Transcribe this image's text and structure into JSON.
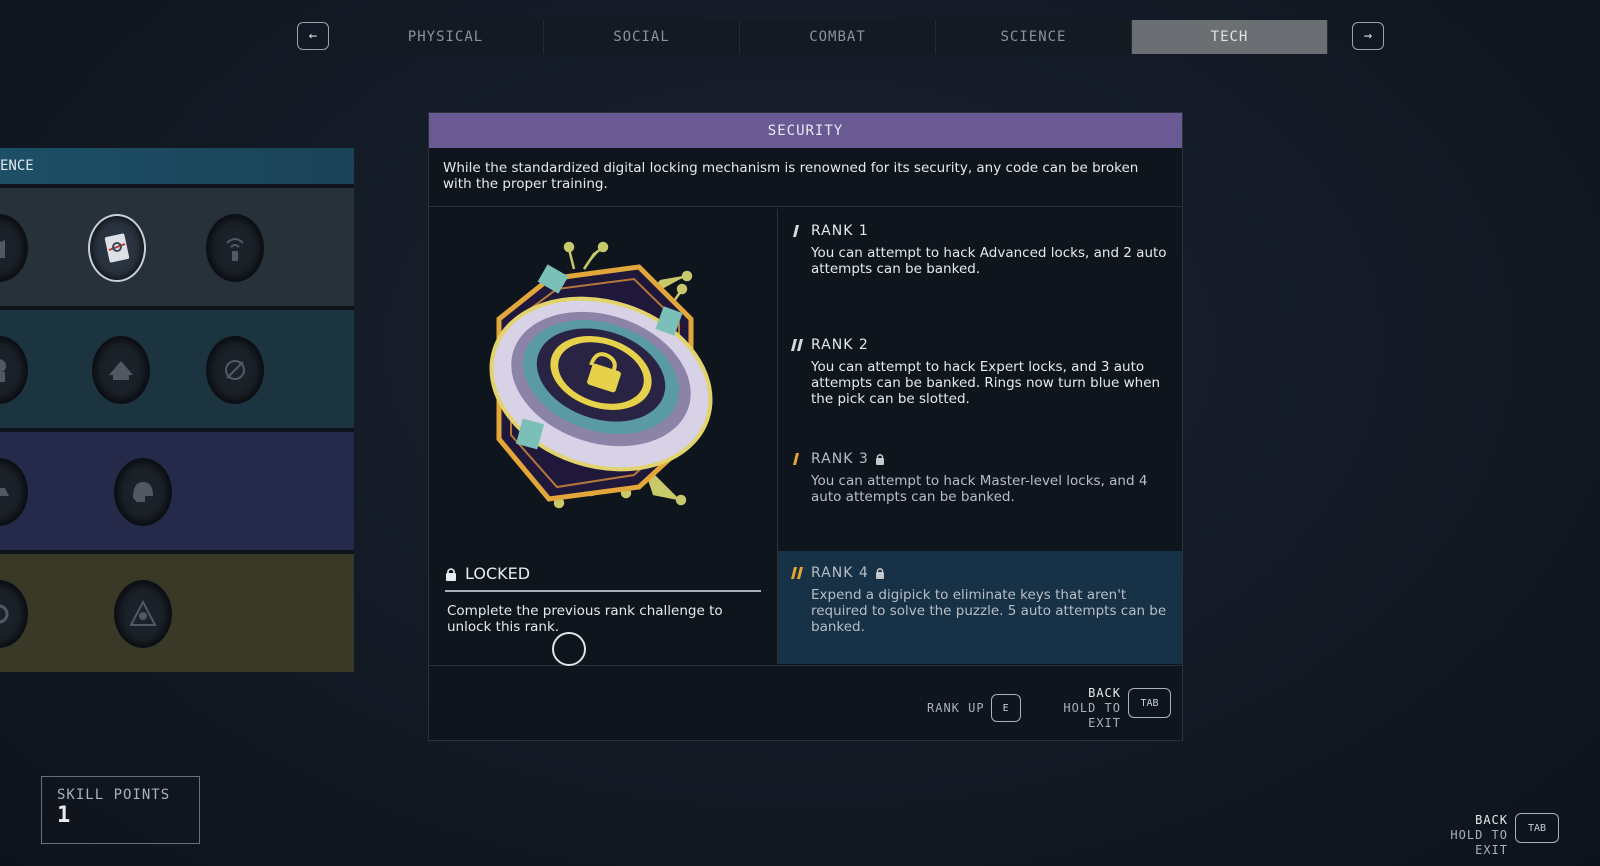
{
  "nav": {
    "prev_icon": "arrow-left-icon",
    "next_icon": "arrow-right-icon",
    "prev_glyph": "←",
    "next_glyph": "→",
    "tabs": [
      {
        "label": "PHYSICAL",
        "active": false
      },
      {
        "label": "SOCIAL",
        "active": false
      },
      {
        "label": "COMBAT",
        "active": false
      },
      {
        "label": "SCIENCE",
        "active": false
      },
      {
        "label": "TECH",
        "active": true
      }
    ]
  },
  "tree": {
    "header": "ENCE",
    "row_colors": [
      "#27313a",
      "#1c3340",
      "#262a4a",
      "#3a3928"
    ]
  },
  "panel": {
    "title": "SECURITY",
    "title_color": "#6a5a94",
    "description": "While the standardized digital locking mechanism is renowned for its security, any code can be broken with the proper training.",
    "status": "LOCKED",
    "status_desc": "Complete the previous rank challenge to unlock this rank.",
    "ranks": [
      {
        "label": "RANK 1",
        "text": "You can attempt to hack Advanced locks, and 2 auto attempts can be banked.",
        "locked": false
      },
      {
        "label": "RANK 2",
        "text": "You can attempt to hack Expert locks, and 3 auto attempts can be banked. Rings now turn blue when the pick can be slotted.",
        "locked": false
      },
      {
        "label": "RANK 3",
        "text": "You can attempt to hack Master-level locks, and 4 auto attempts can be banked.",
        "locked": true
      },
      {
        "label": "RANK 4",
        "text": "Expend a digipick to eliminate keys that aren't required to solve the puzzle. 5 auto attempts can be banked.",
        "locked": true
      }
    ],
    "footer": {
      "rank_up_label": "RANK UP",
      "rank_up_key": "E",
      "back_label": "BACK",
      "hold_label": "HOLD TO EXIT",
      "back_key": "TAB"
    }
  },
  "skill_points": {
    "label": "SKILL POINTS",
    "value": "1"
  },
  "corner_hint": {
    "back_label": "BACK",
    "hold_label": "HOLD TO EXIT",
    "key": "TAB"
  },
  "colors": {
    "accent_purple": "#6a5a94",
    "rank_active_bg": "#173146",
    "rank_mark": "#e5a532"
  }
}
